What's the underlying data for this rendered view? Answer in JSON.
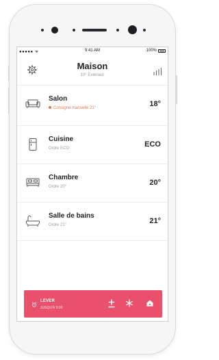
{
  "status_bar": {
    "signal": "●●●●● ᯤ",
    "time": "9:41 AM",
    "battery": "100%"
  },
  "header": {
    "title": "Maison",
    "subtitle": "10° Extérieur"
  },
  "rooms": [
    {
      "name": "Salon",
      "detail": "Consigne manuelle 21°",
      "temp": "18°",
      "icon": "sofa-icon",
      "alert": true
    },
    {
      "name": "Cuisine",
      "detail": "Ordre ECO",
      "temp": "ECO",
      "icon": "fridge-icon",
      "alert": false
    },
    {
      "name": "Chambre",
      "detail": "Ordre 20°",
      "temp": "20°",
      "icon": "bed-icon",
      "alert": false
    },
    {
      "name": "Salle de bains",
      "detail": "Ordre 21°",
      "temp": "21°",
      "icon": "bathtub-icon",
      "alert": false
    }
  ],
  "footer": {
    "label": "LEVER",
    "sublabel": "JUSQU'À 9:00",
    "color": "#ea4f6b"
  },
  "colors": {
    "accent": "#ea4f6b",
    "alert": "#e8744f"
  }
}
